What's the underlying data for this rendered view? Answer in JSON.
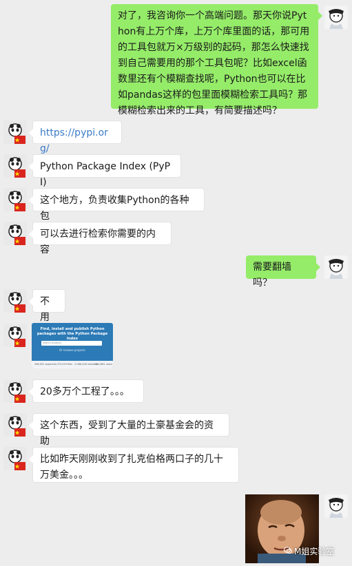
{
  "messages": [
    {
      "side": "right",
      "text": "对了，我咨询你一个高端问题。那天你说Python有上万个库，上万个库里面的话，那可用的工具包就万×万级别的起码，那怎么快速找到自己需要用的那个工具包呢？比如excel函数里还有个模糊查找呢，Python也可以在比如pandas这样的包里面模糊检索工具吗？那模糊检索出来的工具，有简要描述吗？"
    },
    {
      "side": "left",
      "text": "https://pypi.org/",
      "is_link": true
    },
    {
      "side": "left",
      "text": "Python Package Index (PyPI)"
    },
    {
      "side": "left",
      "text": "这个地方，负责收集Python的各种包"
    },
    {
      "side": "left",
      "text": "可以去进行检索你需要的内容"
    },
    {
      "side": "right",
      "text": "需要翻墙吗？"
    },
    {
      "side": "left",
      "text": "不用"
    },
    {
      "side": "left",
      "type": "image",
      "image": {
        "headline": "Find, install and publish Python packages with the Python Package Index",
        "search_placeholder": "Search projects",
        "browse_link": "Or browse projects",
        "stats": [
          "266,502 projects",
          "2,075,434 files",
          "2,086,428 releases",
          "384,661 users"
        ]
      }
    },
    {
      "side": "left",
      "text": "20多万个工程了。。。"
    },
    {
      "side": "left",
      "text": "这个东西，受到了大量的土豪基金会的资助"
    },
    {
      "side": "left",
      "text": "比如昨天刚刚收到了扎克伯格两口子的几十万美金。。。"
    },
    {
      "side": "right",
      "type": "photo"
    }
  ],
  "watermark": "M姐实验室",
  "colors": {
    "background": "#ededed",
    "right_bubble": "#95ec69",
    "left_bubble": "#ffffff",
    "link": "#3a7bc8"
  }
}
